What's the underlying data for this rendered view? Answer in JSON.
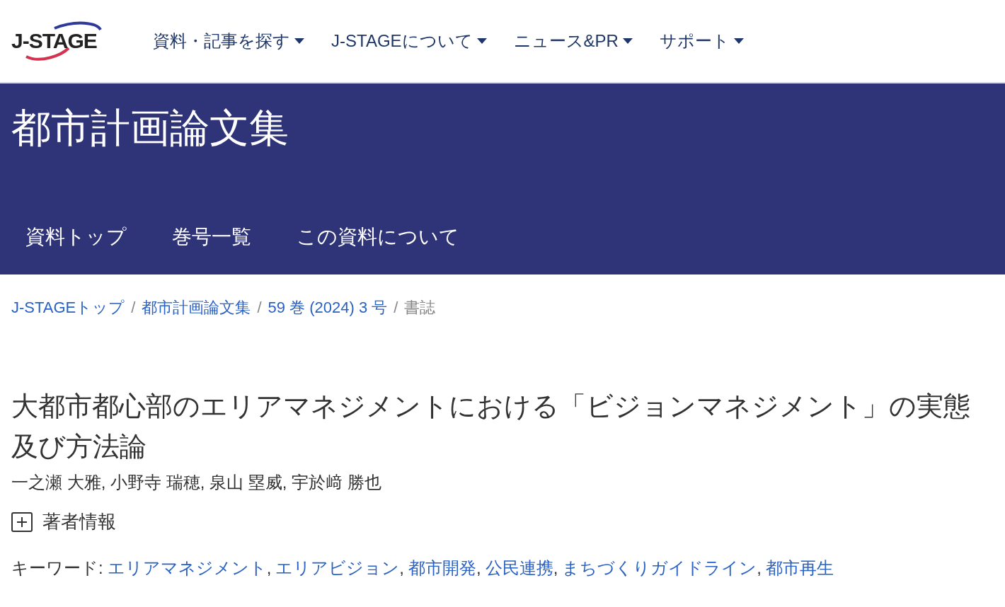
{
  "logo": {
    "text": "J-STAGE"
  },
  "nav": [
    {
      "label": "資料・記事を探す"
    },
    {
      "label": "J-STAGEについて"
    },
    {
      "label": "ニュース&PR"
    },
    {
      "label": "サポート"
    }
  ],
  "banner": {
    "title": "都市計画論文集",
    "tabs": [
      {
        "label": "資料トップ"
      },
      {
        "label": "巻号一覧"
      },
      {
        "label": "この資料について"
      }
    ]
  },
  "breadcrumb": {
    "separator": "/",
    "items": [
      {
        "label": "J-STAGEトップ",
        "link": true
      },
      {
        "label": "都市計画論文集",
        "link": true
      },
      {
        "label": "59 巻 (2024) 3 号",
        "link": true
      },
      {
        "label": "書誌",
        "link": false
      }
    ]
  },
  "article": {
    "title": "大都市都心部のエリアマネジメントにおける「ビジョンマネジメント」の実態及び方法論",
    "authors": "一之瀬 大雅, 小野寺 瑞穂, 泉山 塁威, 宇於﨑 勝也",
    "author_info": {
      "label": "著者情報",
      "expanded": false
    },
    "keywords": {
      "label": "キーワード:",
      "separator": ",",
      "items": [
        "エリアマネジメント",
        "エリアビジョン",
        "都市開発",
        "公民連携",
        "まちづくりガイドライン",
        "都市再生"
      ]
    }
  }
}
